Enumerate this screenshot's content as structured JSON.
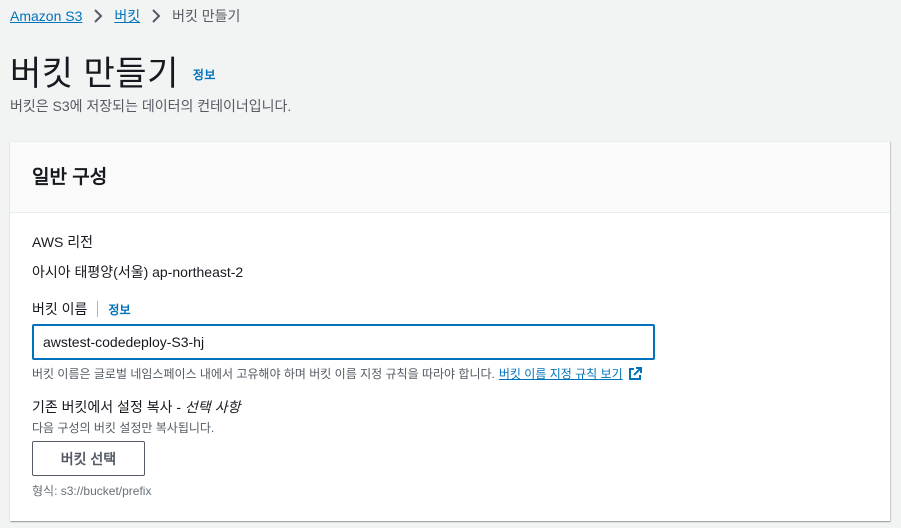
{
  "breadcrumb": {
    "items": [
      {
        "label": "Amazon S3"
      },
      {
        "label": "버킷"
      }
    ],
    "current": "버킷 만들기"
  },
  "page": {
    "title": "버킷 만들기",
    "info": "정보",
    "description": "버킷은 S3에 저장되는 데이터의 컨테이너입니다."
  },
  "panel": {
    "title": "일반 구성",
    "region": {
      "label": "AWS 리전",
      "value": "아시아 태평양(서울) ap-northeast-2"
    },
    "bucket_name": {
      "label": "버킷 이름",
      "info": "정보",
      "value": "awstest-codedeploy-S3-hj",
      "hint": "버킷 이름은 글로벌 네임스페이스 내에서 고유해야 하며 버킷 이름 지정 규칙을 따라야 합니다.",
      "rules_link": "버킷 이름 지정 규칙 보기"
    },
    "copy_settings": {
      "label": "기존 버킷에서 설정 복사 -",
      "optional": "선택 사항",
      "description": "다음 구성의 버킷 설정만 복사됩니다.",
      "button": "버킷 선택",
      "format": "형식: s3://bucket/prefix"
    }
  },
  "colors": {
    "link": "#0073bb",
    "background": "#f2f3f3",
    "text": "#16191f",
    "muted": "#545b64"
  },
  "icons": {
    "breadcrumb_separator": "chevron-right-icon",
    "external_link": "external-link-icon"
  }
}
